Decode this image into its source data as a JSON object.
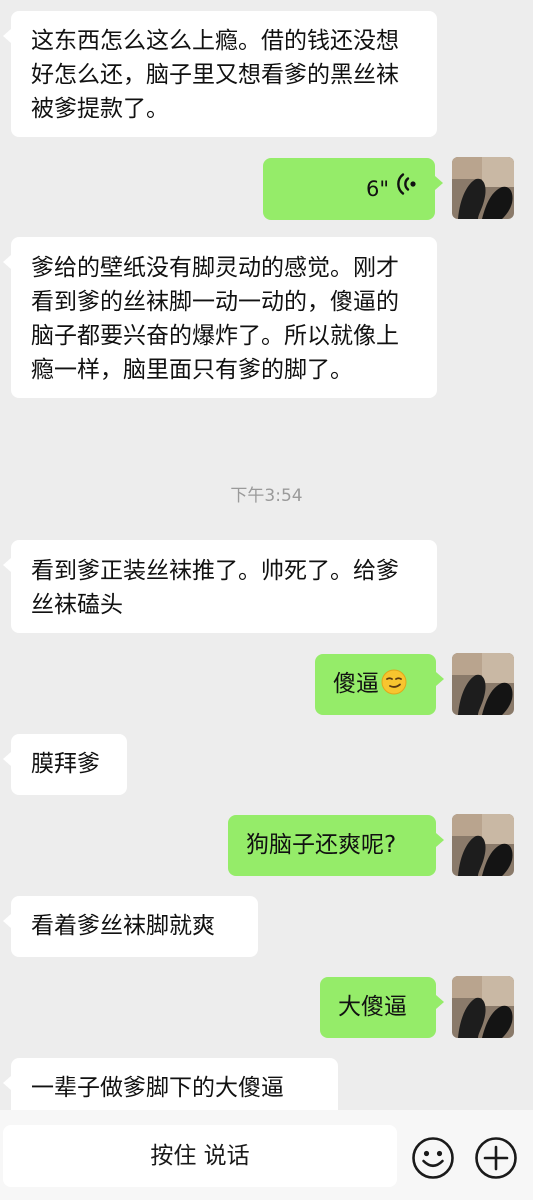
{
  "messages": [
    {
      "side": "in",
      "text": "这东西怎么这么上瘾。借的钱还没想好怎么还，脑子里又想看爹的黑丝袜被爹提款了。"
    },
    {
      "side": "out",
      "type": "voice",
      "duration": "6\""
    },
    {
      "side": "in",
      "text": "爹给的壁纸没有脚灵动的感觉。刚才看到爹的丝袜脚一动一动的，傻逼的脑子都要兴奋的爆炸了。所以就像上瘾一样，脑里面只有爹的脚了。"
    },
    {
      "side": "in",
      "text": "看到爹正装丝袜推了。帅死了。给爹丝袜磕头"
    },
    {
      "side": "out",
      "text": "傻逼",
      "emoji": "smirk-face-emoji"
    },
    {
      "side": "in",
      "text": "膜拜爹"
    },
    {
      "side": "out",
      "text": "狗脑子还爽呢?"
    },
    {
      "side": "in",
      "text": "看着爹丝袜脚就爽"
    },
    {
      "side": "out",
      "text": "大傻逼"
    },
    {
      "side": "in",
      "text": "一辈子做爹脚下的大傻逼"
    }
  ],
  "timestamp": "下午3:54",
  "input_bar": {
    "hold_to_talk": "按住 说话",
    "emoji_icon": "smile-emoji-icon",
    "plus_icon": "plus-circle-icon"
  },
  "colors": {
    "background": "#ededed",
    "incoming_bubble": "#ffffff",
    "outgoing_bubble": "#95ec69",
    "timestamp_text": "#9a9a9a"
  }
}
